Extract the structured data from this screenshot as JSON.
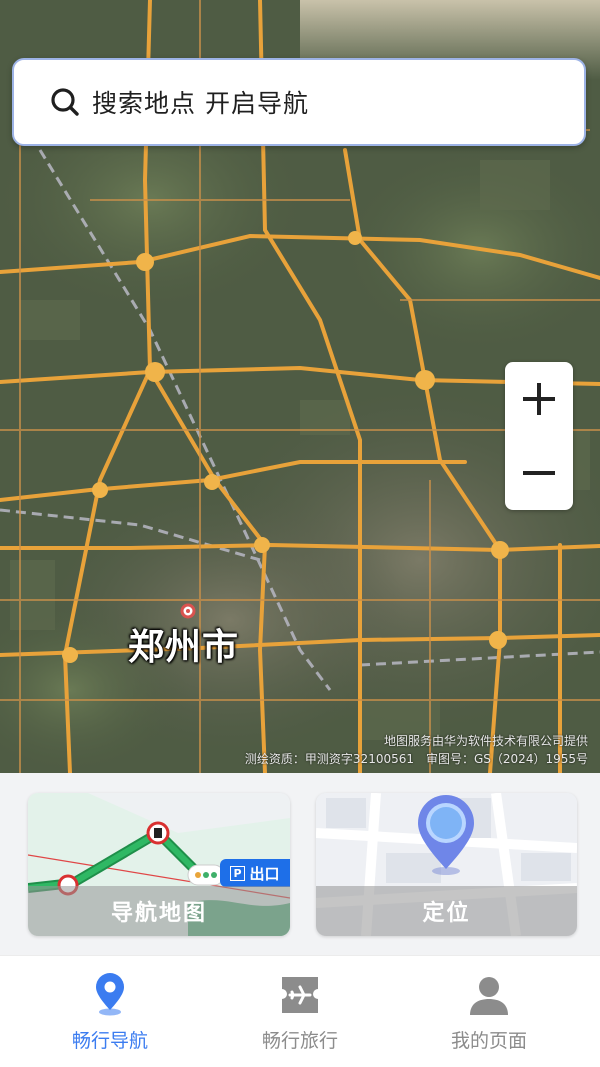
{
  "search": {
    "placeholder": "搜索地点 开启导航"
  },
  "map": {
    "city_label": "郑州市",
    "attribution_line1": "地图服务由华为软件技术有限公司提供",
    "attribution_line2": "测绘资质：甲测资字32100561　审图号：GS（2024）1955号",
    "zoom_in_icon": "plus-icon",
    "zoom_out_icon": "minus-icon"
  },
  "cards": {
    "navigation": {
      "label": "导航地图",
      "exit_badge": "出口"
    },
    "location": {
      "label": "定位"
    }
  },
  "tabs": [
    {
      "label": "畅行导航",
      "icon": "location-pin-icon",
      "active": true
    },
    {
      "label": "畅行旅行",
      "icon": "ticket-plane-icon",
      "active": false
    },
    {
      "label": "我的页面",
      "icon": "user-icon",
      "active": false
    }
  ],
  "colors": {
    "accent": "#3b7cf0",
    "road": "#e8a23a",
    "inactive": "#8c8c8c"
  }
}
